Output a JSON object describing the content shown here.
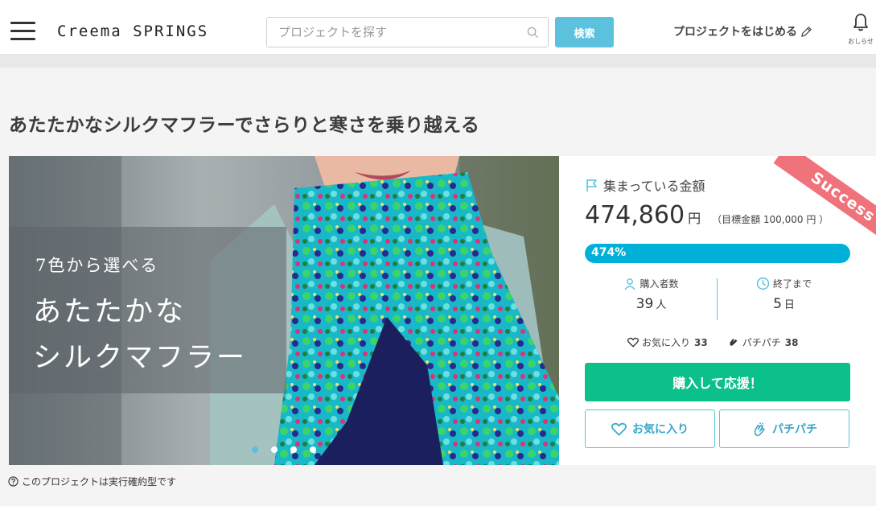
{
  "header": {
    "logo": "Creema SPRINGS",
    "search_placeholder": "プロジェクトを探す",
    "search_button": "検索",
    "start_project": "プロジェクトをはじめる",
    "notifications_label": "おしらせ"
  },
  "project": {
    "title": "あたたかなシルクマフラーでさらりと寒さを乗り越える",
    "hero": {
      "line1": "7色から選べる",
      "line2": "あたたかな",
      "line3": "シルクマフラー",
      "slide_count": 4,
      "active_slide": 1
    },
    "status_ribbon": "Success",
    "raised_label": "集まっている金額",
    "raised_amount": "474,860",
    "currency": "円",
    "goal_text": "（目標金額 100,000 円 ）",
    "progress_text": "474%",
    "progress_fraction": 1.0,
    "buyers_label": "購入者数",
    "buyers_value": "39",
    "buyers_unit": "人",
    "remaining_label": "終了まで",
    "remaining_value": "5",
    "remaining_unit": "日",
    "favorites_label": "お気に入り",
    "favorites_count": "33",
    "pachi_label": "パチパチ",
    "pachi_count": "38",
    "buy_button": "購入して応援！",
    "fav_button": "お気に入り",
    "pachi_button": "パチパチ",
    "note": "このプロジェクトは実行確約型です"
  },
  "colors": {
    "accent": "#5bc1dc",
    "progress": "#00b0d8",
    "buy": "#0cc08b",
    "ribbon": "#f0727b"
  }
}
